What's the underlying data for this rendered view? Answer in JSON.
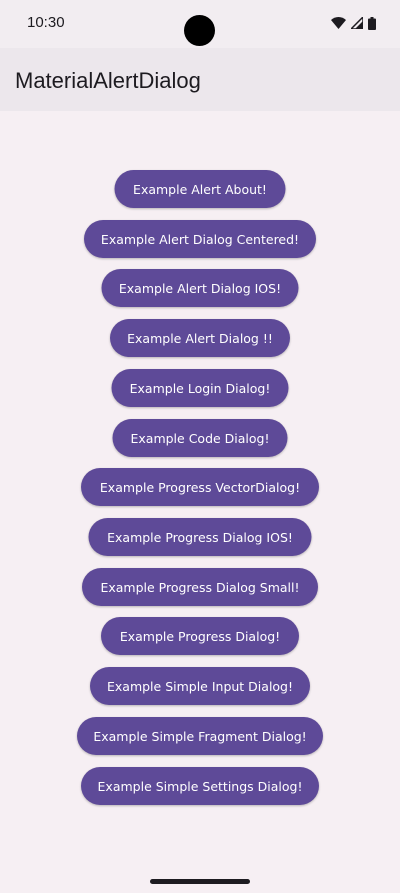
{
  "status_bar": {
    "time": "10:30",
    "icons": [
      "wifi-icon",
      "signal-icon",
      "battery-icon"
    ]
  },
  "app_bar": {
    "title": "MaterialAlertDialog"
  },
  "buttons": [
    "Example Alert About!",
    "Example Alert Dialog Centered!",
    "Example Alert Dialog IOS!",
    "Example Alert Dialog !!",
    "Example Login Dialog!",
    "Example Code Dialog!",
    "Example Progress VectorDialog!",
    "Example Progress Dialog IOS!",
    "Example Progress Dialog Small!",
    "Example Progress Dialog!",
    "Example Simple Input Dialog!",
    "Example Simple Fragment Dialog!",
    "Example Simple Settings Dialog!"
  ],
  "colors": {
    "button_bg": "#5e4a98",
    "button_text": "#ffffff",
    "page_bg": "#f6eff3",
    "app_bar_bg": "#ece7ec"
  }
}
